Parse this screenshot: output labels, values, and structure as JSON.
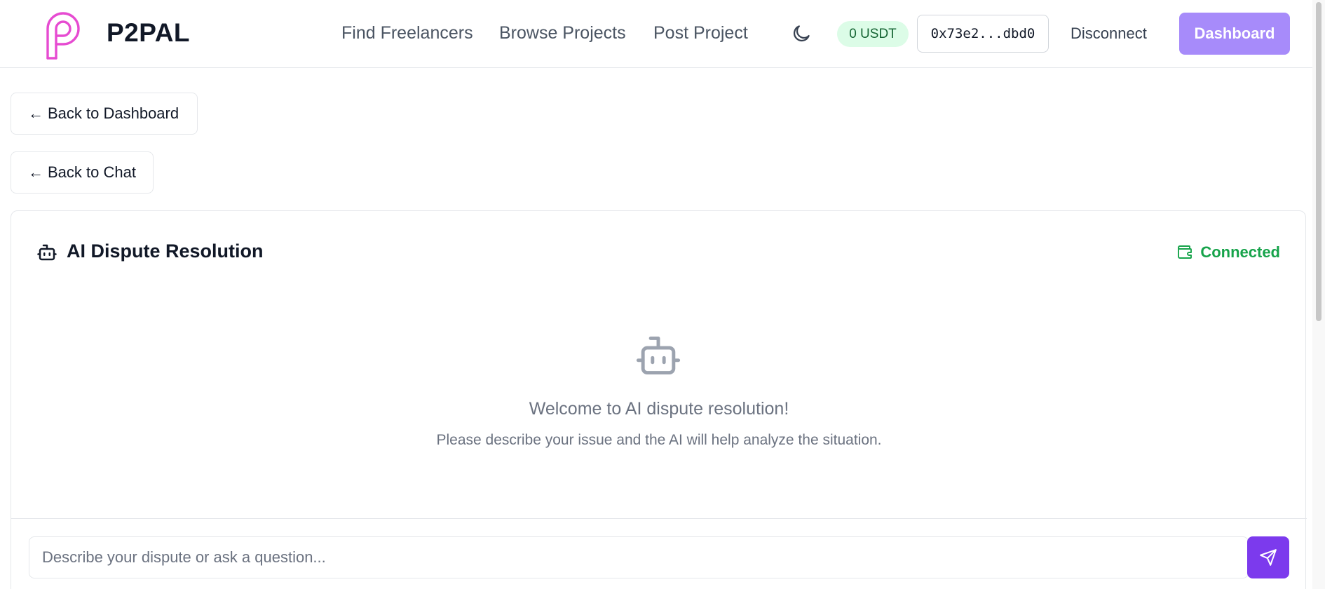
{
  "header": {
    "brand": "P2PAL",
    "nav": {
      "find_freelancers": "Find Freelancers",
      "browse_projects": "Browse Projects",
      "post_project": "Post Project"
    },
    "theme_icon": "moon-icon",
    "balance": "0 USDT",
    "wallet_address": "0x73e2...dbd0",
    "disconnect_label": "Disconnect",
    "dashboard_label": "Dashboard"
  },
  "back_buttons": {
    "dashboard": "Back to Dashboard",
    "chat": "Back to Chat",
    "arrow": "←"
  },
  "dispute": {
    "title": "AI Dispute Resolution",
    "title_icon": "bot-icon",
    "status": "Connected",
    "status_icon": "wallet-icon",
    "empty_icon": "bot-icon",
    "welcome_title": "Welcome to AI dispute resolution!",
    "welcome_subtitle": "Please describe your issue and the AI will help analyze the situation.",
    "input_placeholder": "Describe your dispute or ask a question...",
    "input_value": "",
    "send_icon": "send-icon"
  },
  "colors": {
    "brand_pink": "#e64bd1",
    "accent_purple": "#7c3aed",
    "dashboard_button": "#a78bfa",
    "success_green": "#16a34a",
    "badge_green_bg": "#dcfce7"
  }
}
